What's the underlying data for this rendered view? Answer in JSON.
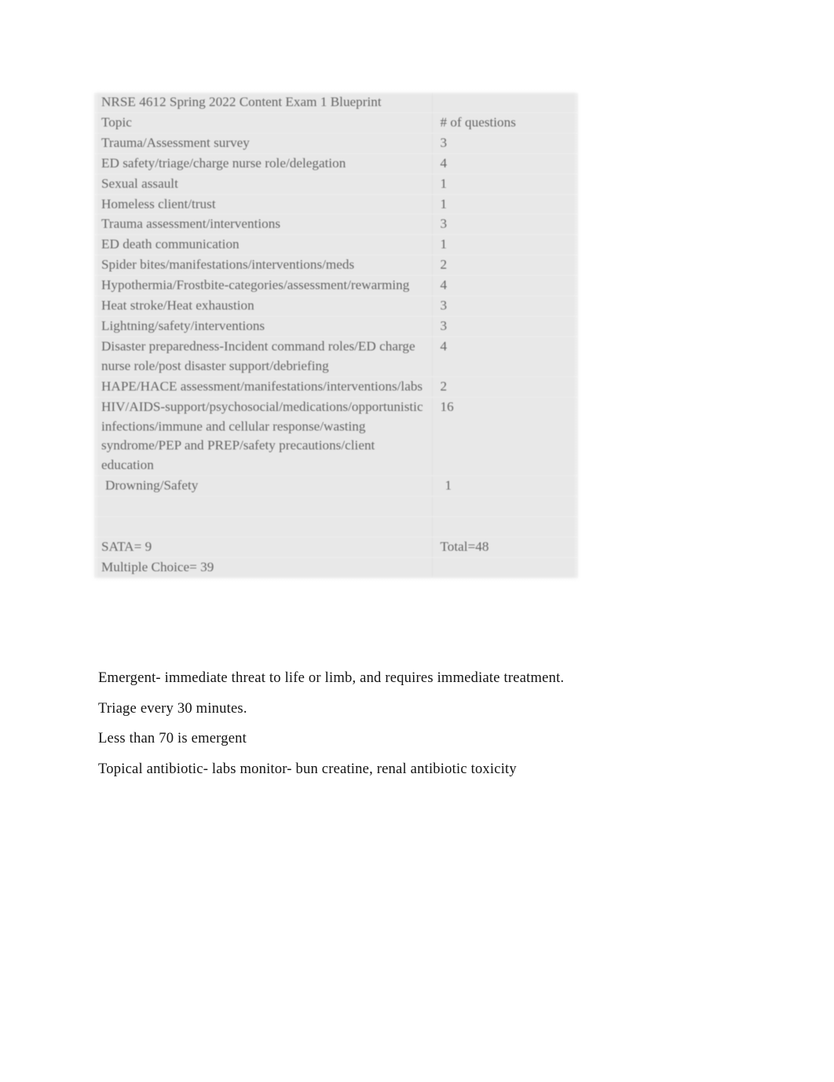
{
  "document": {
    "title": "NRSE 4612 Spring 2022 Content Exam 1 Blueprint"
  },
  "table": {
    "title_row": "NRSE 4612 Spring 2022 Content Exam 1 Blueprint",
    "headers": {
      "topic": "Topic",
      "count": "# of questions"
    },
    "rows": [
      {
        "topic": "Trauma/Assessment survey",
        "count": "3"
      },
      {
        "topic": "ED safety/triage/charge nurse role/delegation",
        "count": "4"
      },
      {
        "topic": "Sexual assault",
        "count": "1"
      },
      {
        "topic": "Homeless client/trust",
        "count": "1"
      },
      {
        "topic": "Trauma assessment/interventions",
        "count": "3"
      },
      {
        "topic": "ED death communication",
        "count": "1"
      },
      {
        "topic": "Spider bites/manifestations/interventions/meds",
        "count": "2"
      },
      {
        "topic": "Hypothermia/Frostbite-categories/assessment/rewarming",
        "count": "4"
      },
      {
        "topic": "Heat stroke/Heat exhaustion",
        "count": "3"
      },
      {
        "topic": "Lightning/safety/interventions",
        "count": "3"
      },
      {
        "topic": "Disaster preparedness-Incident command roles/ED charge nurse role/post disaster support/debriefing",
        "count": "4"
      },
      {
        "topic": "HAPE/HACE assessment/manifestations/interventions/labs",
        "count": "2"
      },
      {
        "topic": "HIV/AIDS-support/psychosocial/medications/opportunistic infections/immune and cellular response/wasting syndrome/PEP and PREP/safety precautions/client education",
        "count": "16"
      },
      {
        "topic": "Drowning/Safety",
        "count": "1"
      },
      {
        "topic": "",
        "count": ""
      },
      {
        "topic": "",
        "count": ""
      }
    ],
    "summary": {
      "sata": "SATA= 9",
      "total": "Total=48",
      "multiple_choice": "Multiple Choice= 39"
    }
  },
  "notes": {
    "lines": [
      "Emergent- immediate threat to life or limb, and requires immediate treatment.",
      "Triage every 30 minutes.",
      "Less than 70 is emergent",
      "Topical antibiotic- labs monitor- bun creatine, renal antibiotic toxicity"
    ]
  },
  "colors": {
    "page_background": "#ffffff",
    "table_cell_background": "#e8e8e8",
    "table_text": "#5d5d5d",
    "body_text": "#141414"
  }
}
